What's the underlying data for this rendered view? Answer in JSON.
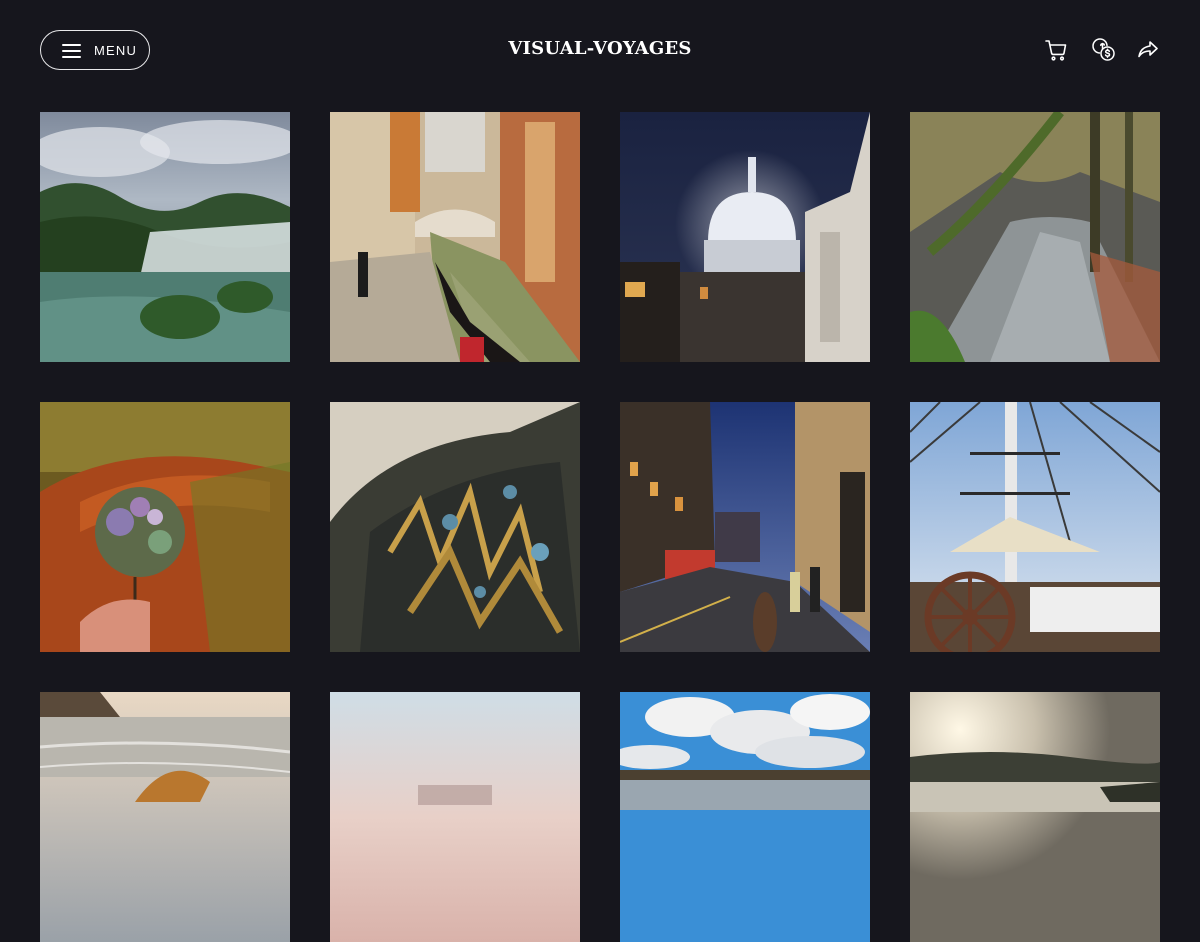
{
  "header": {
    "menu_label": "MENU",
    "brand": "VISUAL-VOYAGES",
    "icons": [
      "menu-icon",
      "cart-icon",
      "currency-icon",
      "share-icon"
    ]
  },
  "gallery": {
    "photos": [
      {
        "name": "photo-waterfall-lake"
      },
      {
        "name": "photo-venice-canal"
      },
      {
        "name": "photo-cathedral-dome-night"
      },
      {
        "name": "photo-forest-river"
      },
      {
        "name": "photo-autumn-path-hydrangea"
      },
      {
        "name": "photo-seaweed-closeup"
      },
      {
        "name": "photo-city-street-night"
      },
      {
        "name": "photo-ship-deck-wheel"
      },
      {
        "name": "photo-beach-shell"
      },
      {
        "name": "photo-pastel-sky"
      },
      {
        "name": "photo-blue-sky-shore"
      },
      {
        "name": "photo-sunset-lake"
      }
    ]
  },
  "colors": {
    "background": "#16161d",
    "text": "#ffffff",
    "border": "#e8e8ea"
  }
}
